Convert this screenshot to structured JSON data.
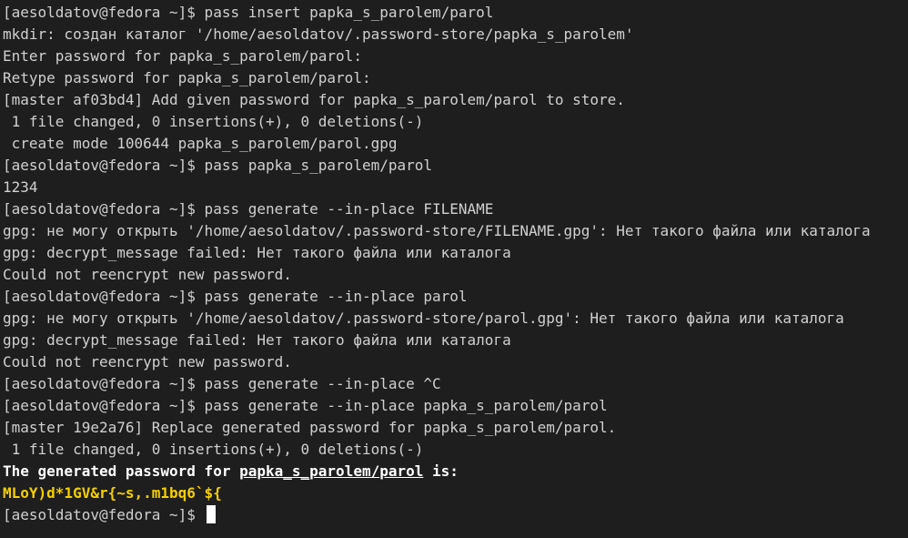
{
  "terminal": {
    "lines": [
      "[aesoldatov@fedora ~]$ pass insert papka_s_parolem/parol",
      "mkdir: создан каталог '/home/aesoldatov/.password-store/papka_s_parolem'",
      "Enter password for papka_s_parolem/parol:",
      "Retype password for papka_s_parolem/parol:",
      "[master af03bd4] Add given password for papka_s_parolem/parol to store.",
      " 1 file changed, 0 insertions(+), 0 deletions(-)",
      " create mode 100644 papka_s_parolem/parol.gpg",
      "[aesoldatov@fedora ~]$ pass papka_s_parolem/parol",
      "1234",
      "[aesoldatov@fedora ~]$ pass generate --in-place FILENAME",
      "gpg: не могу открыть '/home/aesoldatov/.password-store/FILENAME.gpg': Нет такого файла или каталога",
      "gpg: decrypt_message failed: Нет такого файла или каталога",
      "Could not reencrypt new password.",
      "[aesoldatov@fedora ~]$ pass generate --in-place parol",
      "gpg: не могу открыть '/home/aesoldatov/.password-store/parol.gpg': Нет такого файла или каталога",
      "gpg: decrypt_message failed: Нет такого файла или каталога",
      "Could not reencrypt new password.",
      "[aesoldatov@fedora ~]$ pass generate --in-place ^C",
      "[aesoldatov@fedora ~]$ pass generate --in-place papka_s_parolem/parol",
      "[master 19e2a76] Replace generated password for papka_s_parolem/parol.",
      " 1 file changed, 0 insertions(+), 0 deletions(-)"
    ],
    "generated": {
      "prefix": "The generated password for ",
      "path": "papka_s_parolem/parol",
      "suffix": " is:",
      "password": "MLoY)d*1GV&r{~s,.m1bq6`${"
    },
    "prompt": "[aesoldatov@fedora ~]$ ",
    "colors": {
      "background": "#1e1e1e",
      "text": "#d0d0d0",
      "bold_text": "#ffffff",
      "password": "#f5d000"
    }
  }
}
